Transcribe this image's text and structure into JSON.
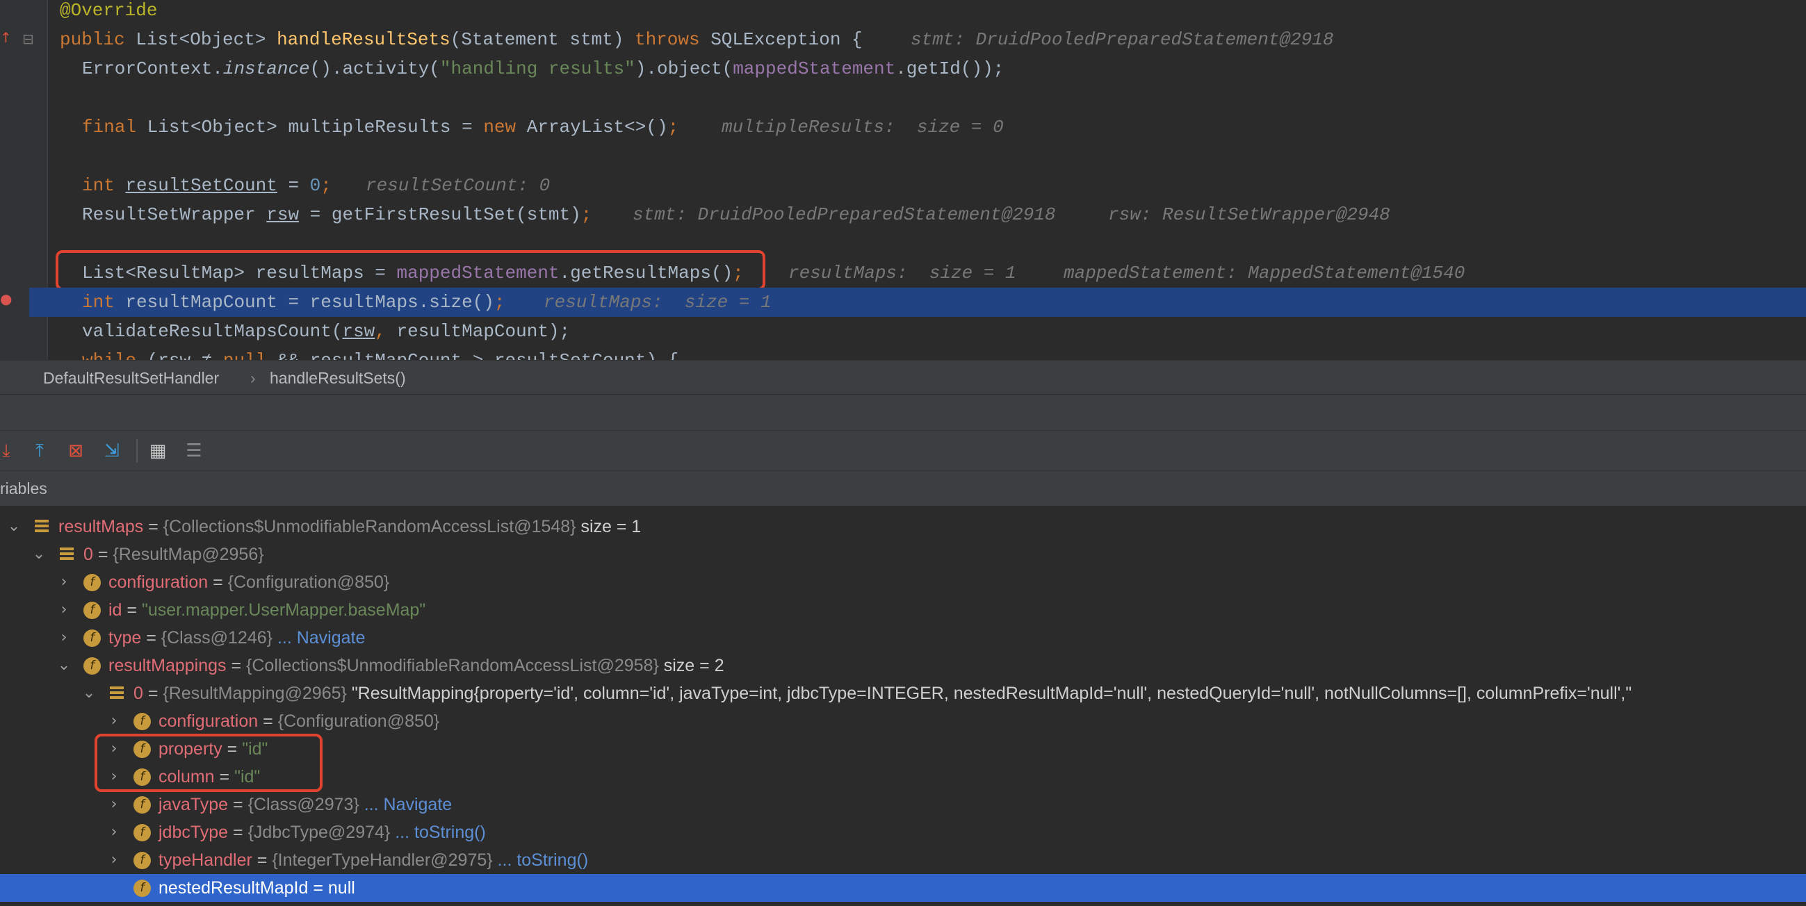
{
  "editor": {
    "lines": {
      "l1": {
        "annotation": "@Override"
      },
      "l2": {
        "kw_public": "public",
        "t1": "List<Object>",
        "method": "handleResultSets",
        "t2": "(Statement stmt)",
        "kw_throws": "throws",
        "t3": "SQLException",
        "t4": "{",
        "hint": "stmt: DruidPooledPreparedStatement@2918"
      },
      "l3": {
        "t1": "ErrorContext.",
        "inst": "instance",
        "t2": "().activity(",
        "str": "\"handling results\"",
        "t3": ").object(",
        "fld": "mappedStatement",
        "t4": ".getId());"
      },
      "l4": {
        "kw_final": "final",
        "t1": "List<Object> multipleResults = ",
        "kw_new": "new",
        "t2": "ArrayList<>()",
        "semi": ";",
        "hint": "multipleResults:  size = 0"
      },
      "l5": {
        "kw_int": "int",
        "var": "resultSetCount",
        "t1": " = ",
        "num": "0",
        "semi": ";",
        "hint": "resultSetCount: 0"
      },
      "l6": {
        "t1": "ResultSetWrapper ",
        "var": "rsw",
        "t2": " = getFirstResultSet(stmt)",
        "semi": ";",
        "hint1": "stmt: DruidPooledPreparedStatement@2918",
        "hint2": "rsw: ResultSetWrapper@2948"
      },
      "l7": {
        "t1": "List<ResultMap> resultMaps = ",
        "fld": "mappedStatement",
        "t2": ".getResultMaps()",
        "semi": ";",
        "hint1": "resultMaps:  size = 1",
        "hint2": "mappedStatement: MappedStatement@1540"
      },
      "l8": {
        "kw_int": "int",
        "t1": " resultMapCount = resultMaps.size()",
        "semi": ";",
        "hint": "resultMaps:  size = 1"
      },
      "l9": {
        "t1": "validateResultMapsCount(",
        "var": "rsw",
        "comma": ",",
        "t2": " resultMapCount);"
      },
      "l10": {
        "kw_while": "while",
        "t1": " (",
        "var": "rsw",
        "t2": " ≠ ",
        "kw_null": "null",
        "t3": " && resultMapCount > ",
        "var2": "resultSetCount",
        "t4": ") {"
      }
    }
  },
  "breadcrumb": {
    "class_name": "DefaultResultSetHandler",
    "sep": "›",
    "method_name": "handleResultSets()"
  },
  "panel": {
    "tab_label": "riables",
    "toolbar": {
      "icons": [
        "step-into-icon",
        "step-out-icon",
        "drop-frame-icon",
        "run-to-cursor-icon",
        "evaluate-table-icon",
        "trace-icon"
      ],
      "colors": {
        "step": "#e0503a",
        "out": "#3d9ee0",
        "drop": "#e0503a",
        "run": "#3d9ee0",
        "muted": "#8a8a8a"
      }
    }
  },
  "tree": {
    "rows": [
      {
        "name": "resultMaps",
        "op": " = ",
        "value": "{Collections$UnmodifiableRandomAccessList@1548}",
        "extra": "size = 1"
      },
      {
        "name": "0",
        "op": " = ",
        "value": "{ResultMap@2956}"
      },
      {
        "name": "configuration",
        "op": " = ",
        "value": "{Configuration@850}"
      },
      {
        "name": "id",
        "op": " = ",
        "value": "\"user.mapper.UserMapper.baseMap\""
      },
      {
        "name": "type",
        "op": " = ",
        "value": "{Class@1246}",
        "nav": "... Navigate"
      },
      {
        "name": "resultMappings",
        "op": " = ",
        "value": "{Collections$UnmodifiableRandomAccessList@2958}",
        "extra": "size = 2"
      },
      {
        "name": "0",
        "op": " = ",
        "value": "{ResultMapping@2965}",
        "extra": "\"ResultMapping{property='id', column='id', javaType=int, jdbcType=INTEGER, nestedResultMapId='null', nestedQueryId='null', notNullColumns=[], columnPrefix='null',\""
      },
      {
        "name": "configuration",
        "op": " = ",
        "value": "{Configuration@850}"
      },
      {
        "name": "property",
        "op": " = ",
        "value": "\"id\""
      },
      {
        "name": "column",
        "op": " = ",
        "value": "\"id\""
      },
      {
        "name": "javaType",
        "op": " = ",
        "value": "{Class@2973}",
        "nav": "... Navigate"
      },
      {
        "name": "jdbcType",
        "op": " = ",
        "value": "{JdbcType@2974}",
        "nav": "... toString()"
      },
      {
        "name": "typeHandler",
        "op": " = ",
        "value": "{IntegerTypeHandler@2975}",
        "nav": "... toString()"
      },
      {
        "name": "nestedResultMapId",
        "op": " = ",
        "value": "null"
      }
    ],
    "field_icon_letter": "f"
  },
  "colors": {
    "highlight_box": "#e0442f",
    "current_line": "#214283",
    "selection": "#2f65ca"
  }
}
